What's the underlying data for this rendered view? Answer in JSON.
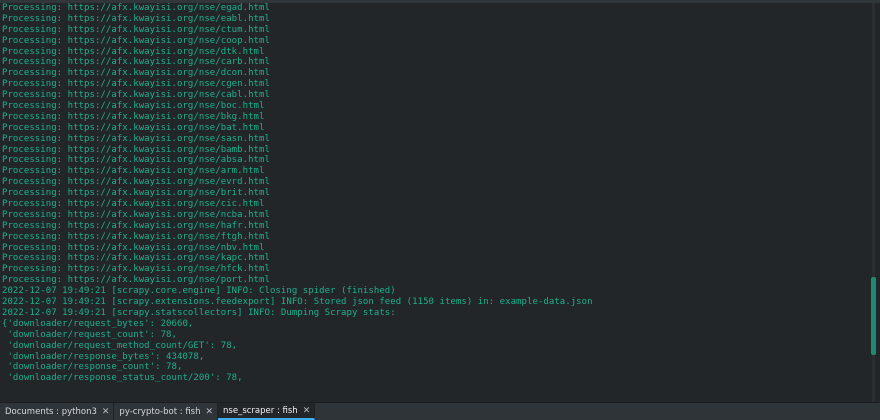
{
  "terminal": {
    "lines": [
      "Processing: https://afx.kwayisi.org/nse/egad.html",
      "Processing: https://afx.kwayisi.org/nse/eabl.html",
      "Processing: https://afx.kwayisi.org/nse/ctum.html",
      "Processing: https://afx.kwayisi.org/nse/coop.html",
      "Processing: https://afx.kwayisi.org/nse/dtk.html",
      "Processing: https://afx.kwayisi.org/nse/carb.html",
      "Processing: https://afx.kwayisi.org/nse/dcon.html",
      "Processing: https://afx.kwayisi.org/nse/cgen.html",
      "Processing: https://afx.kwayisi.org/nse/cabl.html",
      "Processing: https://afx.kwayisi.org/nse/boc.html",
      "Processing: https://afx.kwayisi.org/nse/bkg.html",
      "Processing: https://afx.kwayisi.org/nse/bat.html",
      "Processing: https://afx.kwayisi.org/nse/sasn.html",
      "Processing: https://afx.kwayisi.org/nse/bamb.html",
      "Processing: https://afx.kwayisi.org/nse/absa.html",
      "Processing: https://afx.kwayisi.org/nse/arm.html",
      "Processing: https://afx.kwayisi.org/nse/evrd.html",
      "Processing: https://afx.kwayisi.org/nse/brit.html",
      "Processing: https://afx.kwayisi.org/nse/cic.html",
      "Processing: https://afx.kwayisi.org/nse/ncba.html",
      "Processing: https://afx.kwayisi.org/nse/hafr.html",
      "Processing: https://afx.kwayisi.org/nse/ftgh.html",
      "Processing: https://afx.kwayisi.org/nse/nbv.html",
      "Processing: https://afx.kwayisi.org/nse/kapc.html",
      "Processing: https://afx.kwayisi.org/nse/hfck.html",
      "Processing: https://afx.kwayisi.org/nse/port.html",
      "2022-12-07 19:49:21 [scrapy.core.engine] INFO: Closing spider (finished)",
      "2022-12-07 19:49:21 [scrapy.extensions.feedexport] INFO: Stored json feed (1150 items) in: example-data.json",
      "2022-12-07 19:49:21 [scrapy.statscollectors] INFO: Dumping Scrapy stats:",
      "{'downloader/request_bytes': 20660,",
      " 'downloader/request_count': 78,",
      " 'downloader/request_method_count/GET': 78,",
      " 'downloader/response_bytes': 434078,",
      " 'downloader/response_count': 78,",
      " 'downloader/response_status_count/200': 78,"
    ]
  },
  "tabs": [
    {
      "label": "Documents : python3",
      "close": "✕",
      "active": false
    },
    {
      "label": "py-crypto-bot : fish",
      "close": "✕",
      "active": false
    },
    {
      "label": "nse_scraper : fish",
      "close": "✕",
      "active": true
    }
  ],
  "colors": {
    "background": "#232629",
    "text": "#1cb18d",
    "tab_active_indicator": "#3daee9"
  }
}
